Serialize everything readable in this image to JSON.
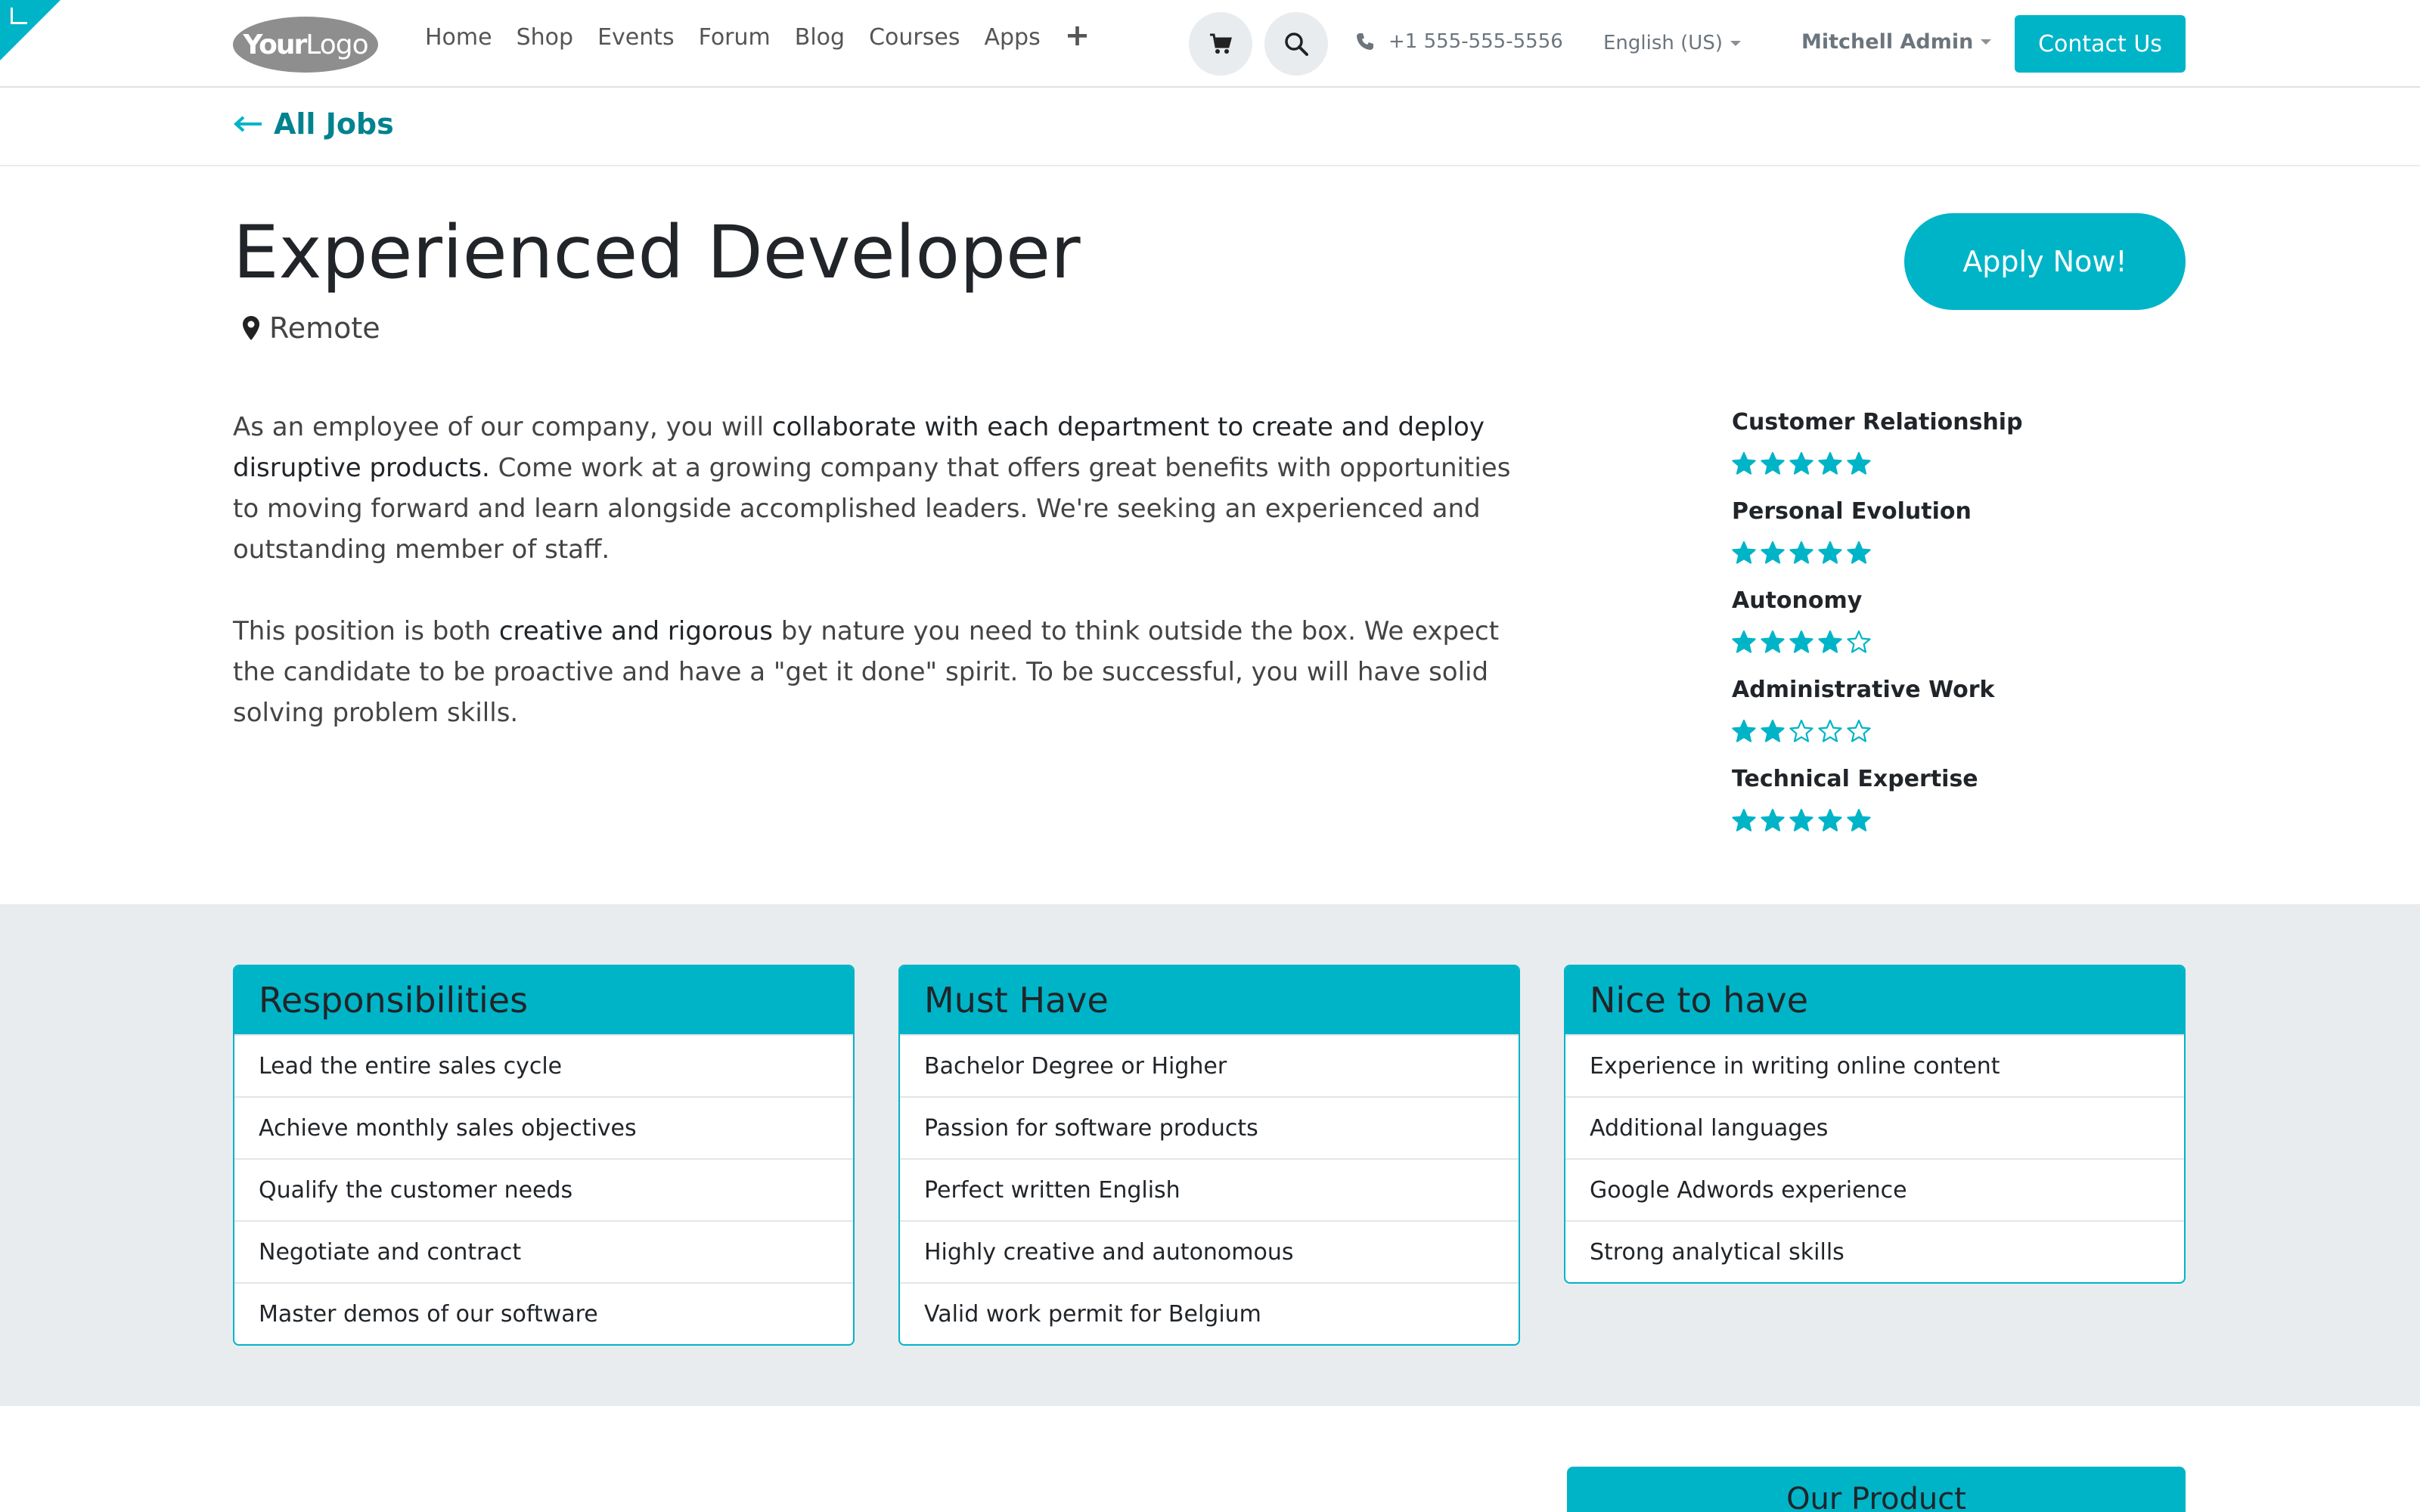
{
  "header": {
    "logo": {
      "part1": "Your",
      "part2": "Logo"
    },
    "nav": [
      "Home",
      "Shop",
      "Events",
      "Forum",
      "Blog",
      "Courses",
      "Apps"
    ],
    "nav_plus": "+",
    "phone": "+1 555-555-5556",
    "language": "English (US)",
    "user": "Mitchell Admin",
    "contact_label": "Contact Us",
    "accent": "#00b4c8"
  },
  "back": {
    "label": "All Jobs"
  },
  "job": {
    "title": "Experienced Developer",
    "location": "Remote",
    "apply_label": "Apply Now!"
  },
  "description": {
    "p1": {
      "a": "As an employee of our company, you will ",
      "b": "collaborate with each department to create and deploy disruptive products.",
      "c": " Come work at a growing company that offers great benefits with opportunities to moving forward and learn alongside accomplished leaders. We're seeking an experienced and outstanding member of staff."
    },
    "p2": {
      "a": "This position is both ",
      "b": "creative and rigorous",
      "c": " by nature you need to think outside the box. We expect the candidate to be proactive and have a \"get it done\" spirit. To be successful, you will have solid solving problem skills."
    }
  },
  "ratings": [
    {
      "label": "Customer Relationship",
      "stars": 5
    },
    {
      "label": "Personal Evolution",
      "stars": 5
    },
    {
      "label": "Autonomy",
      "stars": 4
    },
    {
      "label": "Administrative Work",
      "stars": 2
    },
    {
      "label": "Technical Expertise",
      "stars": 5
    }
  ],
  "cards": [
    {
      "title": "Responsibilities",
      "items": [
        "Lead the entire sales cycle",
        "Achieve monthly sales objectives",
        "Qualify the customer needs",
        "Negotiate and contract",
        "Master demos of our software"
      ]
    },
    {
      "title": "Must Have",
      "items": [
        "Bachelor Degree or Higher",
        "Passion for software products",
        "Perfect written English",
        "Highly creative and autonomous",
        "Valid work permit for Belgium"
      ]
    },
    {
      "title": "Nice to have",
      "items": [
        "Experience in writing online content",
        "Additional languages",
        "Google Adwords experience",
        "Strong analytical skills"
      ]
    }
  ],
  "bottom": {
    "product_title": "Our Product"
  }
}
